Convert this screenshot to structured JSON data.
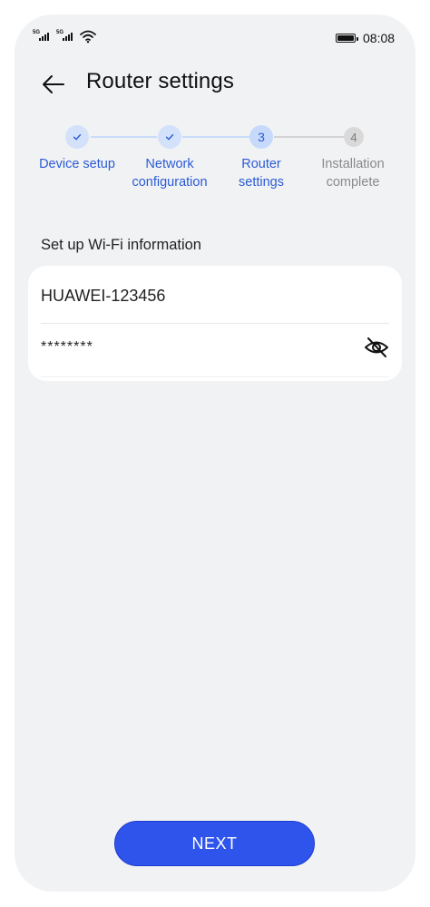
{
  "status_bar": {
    "signal1_label": "5G",
    "signal2_label": "5G",
    "time": "08:08",
    "battery_level": 1.0
  },
  "header": {
    "title": "Router settings"
  },
  "stepper": {
    "steps": [
      {
        "number": "1",
        "label": "Device setup",
        "state": "done"
      },
      {
        "number": "2",
        "label": "Network configuration",
        "state": "done"
      },
      {
        "number": "3",
        "label": "Router settings",
        "state": "current"
      },
      {
        "number": "4",
        "label": "Installation complete",
        "state": "pending"
      }
    ],
    "active_color": "#2a5bd7",
    "inactive_color": "#8a8a8a"
  },
  "form": {
    "section_title": "Set up Wi-Fi information",
    "ssid_value": "HUAWEI-123456",
    "password_value": "********",
    "password_visibility_icon": "eye-off-icon"
  },
  "footer": {
    "next_label": "NEXT",
    "button_color": "#2f54eb"
  }
}
